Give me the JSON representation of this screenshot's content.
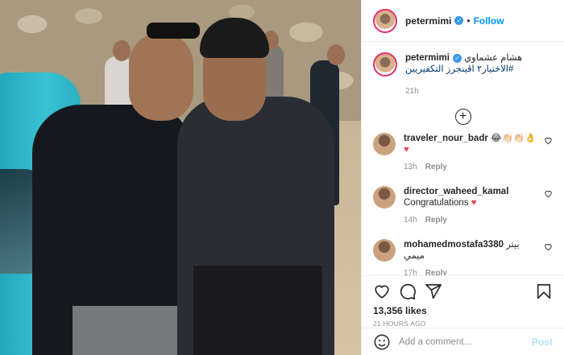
{
  "header": {
    "username": "petermimi",
    "verified_mark": "✓",
    "separator": "•",
    "follow_label": "Follow"
  },
  "caption": {
    "username": "petermimi",
    "text": "هشام عشماوي",
    "hashtag": "#الاختيار٢ اڤينجرز التكفيريين",
    "time": "21h"
  },
  "load_more": "+",
  "comments": [
    {
      "username": "traveler_nour_badr",
      "text": "😂👏🏻👏🏻👌",
      "heart": "♥",
      "time": "13h",
      "reply": "Reply"
    },
    {
      "username": "director_waheed_kamal",
      "text": "Congratulations",
      "heart": "♥",
      "time": "14h",
      "reply": "Reply"
    },
    {
      "username": "mohamedmostafa3380",
      "text": "بيتر ميمي",
      "time": "17h",
      "reply": "Reply"
    }
  ],
  "likes": "13,356 likes",
  "posted": "21 HOURS AGO",
  "add_comment": {
    "placeholder": "Add a comment...",
    "post_label": "Post"
  },
  "icons": {
    "like": "heart-icon",
    "comment": "comment-icon",
    "share": "share-icon",
    "save": "bookmark-icon",
    "emoji": "smiley-icon"
  },
  "colors": {
    "accent": "#0095f6",
    "hashtag": "#00376b",
    "muted": "#8e8e8e",
    "heart": "#ed4956"
  }
}
